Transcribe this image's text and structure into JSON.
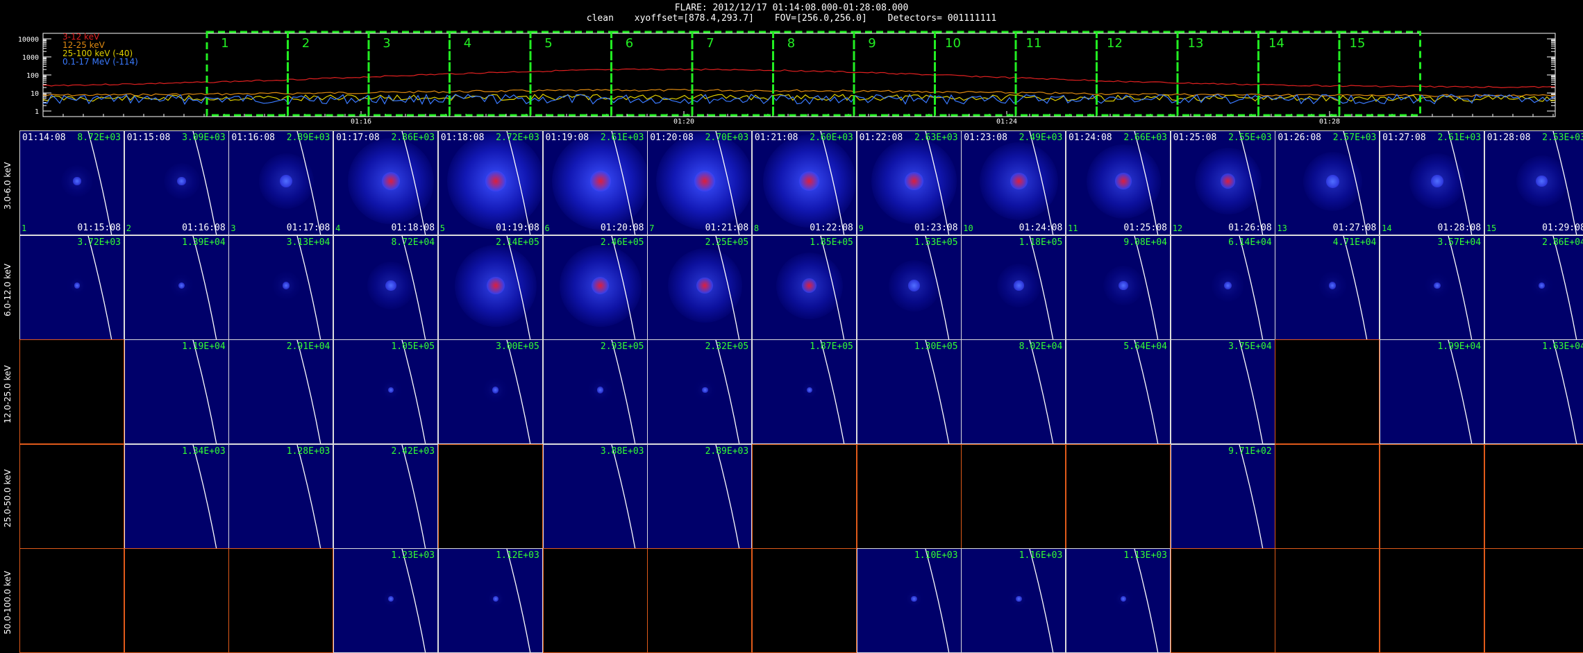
{
  "header": {
    "title": "FLARE: 2012/12/17 01:14:08.000-01:28:08.000",
    "method": "clean",
    "xyoffset": "xyoffset=[878.4,293.7]",
    "fov": "FOV=[256.0,256.0]",
    "detectors": "Detectors= 001111111"
  },
  "lightcurve": {
    "legend": [
      {
        "label": "3-12 keV",
        "color": "#e02020"
      },
      {
        "label": "12-25 keV",
        "color": "#e08a10"
      },
      {
        "label": "25-100 keV (-40)",
        "color": "#e0d000"
      },
      {
        "label": "0.1-17 MeV (-114)",
        "color": "#3a7aff"
      }
    ],
    "y_ticks": [
      "10000",
      "1000",
      "100",
      "10",
      "1"
    ],
    "x_ticks": [
      "01:16",
      "01:20",
      "01:24",
      "01:28"
    ],
    "intervals": [
      "1",
      "2",
      "3",
      "4",
      "5",
      "6",
      "7",
      "8",
      "9",
      "10",
      "11",
      "12",
      "13",
      "14",
      "15"
    ],
    "interval_color": "#22ee22"
  },
  "row_labels": [
    "3.0-6.0 keV",
    "6.0-12.0 keV",
    "12.0-25.0 keV",
    "25.0-50.0 keV",
    "50.0-100.0 keV"
  ],
  "start_times": [
    "01:14:08",
    "01:15:08",
    "01:16:08",
    "01:17:08",
    "01:18:08",
    "01:19:08",
    "01:20:08",
    "01:21:08",
    "01:22:08",
    "01:23:08",
    "01:24:08",
    "01:25:08",
    "01:26:08",
    "01:27:08",
    "01:28:08"
  ],
  "end_times": [
    "01:15:08",
    "01:16:08",
    "01:17:08",
    "01:18:08",
    "01:19:08",
    "01:20:08",
    "01:21:08",
    "01:22:08",
    "01:23:08",
    "01:24:08",
    "01:25:08",
    "01:26:08",
    "01:27:08",
    "01:28:08",
    "01:29:08"
  ],
  "rows": [
    {
      "values": [
        "8.72E+03",
        "3.09E+03",
        "2.89E+03",
        "2.86E+03",
        "2.72E+03",
        "2.61E+03",
        "2.70E+03",
        "2.60E+03",
        "2.63E+03",
        "2.49E+03",
        "2.66E+03",
        "2.55E+03",
        "2.57E+03",
        "2.61E+03",
        "2.53E+03"
      ],
      "intensity": [
        0.15,
        0.2,
        0.45,
        0.85,
        1.0,
        1.0,
        1.0,
        0.95,
        0.85,
        0.75,
        0.7,
        0.6,
        0.5,
        0.45,
        0.4
      ]
    },
    {
      "values": [
        "3.72E+03",
        "1.39E+04",
        "3.13E+04",
        "8.72E+04",
        "2.14E+05",
        "2.46E+05",
        "2.25E+05",
        "1.85E+05",
        "1.53E+05",
        "1.18E+05",
        "9.08E+04",
        "6.14E+04",
        "4.71E+04",
        "3.57E+04",
        "2.86E+04"
      ],
      "intensity": [
        0.02,
        0.05,
        0.1,
        0.35,
        0.8,
        0.8,
        0.7,
        0.6,
        0.4,
        0.3,
        0.25,
        0.15,
        0.1,
        0.06,
        0.04
      ]
    },
    {
      "values": [
        "",
        "1.19E+04",
        "2.91E+04",
        "1.05E+05",
        "3.00E+05",
        "2.93E+05",
        "2.32E+05",
        "1.87E+05",
        "1.30E+05",
        "8.02E+04",
        "5.64E+04",
        "3.75E+04",
        "",
        "1.99E+04",
        "1.63E+04"
      ],
      "intensity": [
        0,
        0,
        0,
        0.03,
        0.06,
        0.05,
        0.03,
        0.02,
        0,
        0,
        0,
        0,
        0,
        0,
        0
      ]
    },
    {
      "values": [
        "",
        "1.34E+03",
        "1.28E+03",
        "2.42E+03",
        "",
        "3.88E+03",
        "2.89E+03",
        "",
        "",
        "",
        "",
        "9.71E+02",
        "",
        "",
        ""
      ],
      "intensity": [
        0,
        0,
        0,
        0,
        0,
        0,
        0,
        0,
        0,
        0,
        0,
        0,
        0,
        0,
        0
      ]
    },
    {
      "values": [
        "",
        "",
        "",
        "1.23E+03",
        "1.12E+03",
        "",
        "",
        "",
        "1.10E+03",
        "1.16E+03",
        "1.13E+03",
        "",
        "",
        "",
        ""
      ],
      "intensity": [
        0,
        0,
        0,
        0.02,
        0.02,
        0,
        0,
        0,
        0.02,
        0.02,
        0.02,
        0,
        0,
        0,
        0
      ]
    }
  ]
}
